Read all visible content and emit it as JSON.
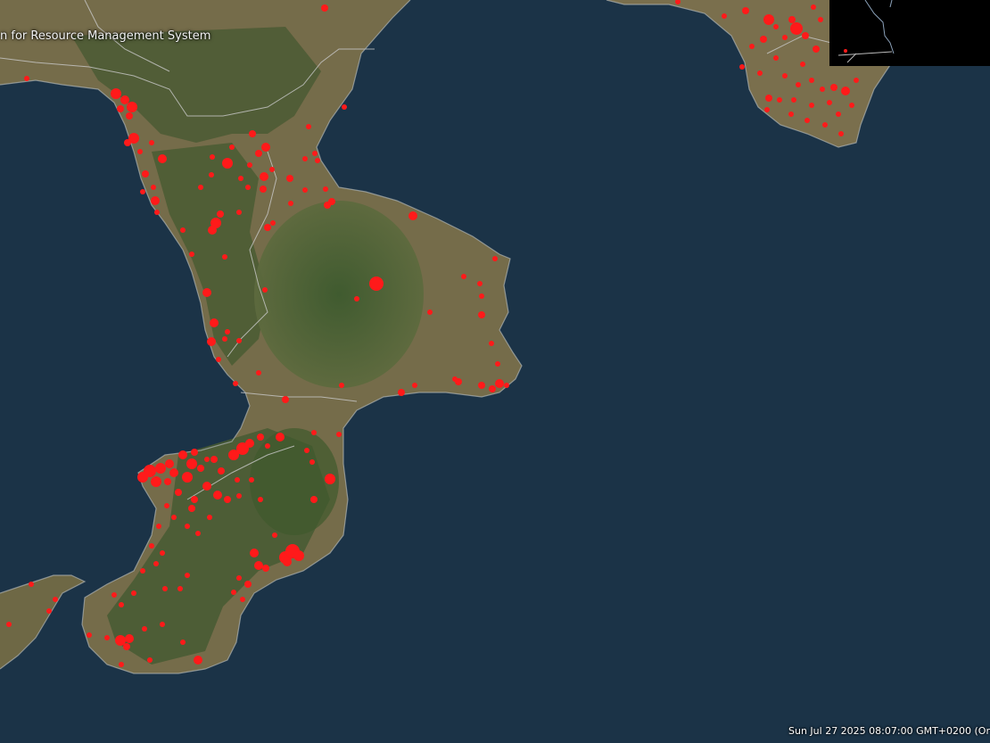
{
  "app": {
    "title_fragment": "n for Resource Management System"
  },
  "map": {
    "type": "satellite",
    "region": "Calabria, southern Italy",
    "fire_marker_color": "#ff1a1a",
    "sea_color": "#1b3347",
    "land_color": "#7a6f4d",
    "boundary_color": "#c9c9c9"
  },
  "status": {
    "timestamp": "Sun Jul 27 2025 08:07:00 GMT+0200 (Or"
  },
  "layers": {
    "fires": "active-fire-detections",
    "overview_inset": "minimap"
  }
}
